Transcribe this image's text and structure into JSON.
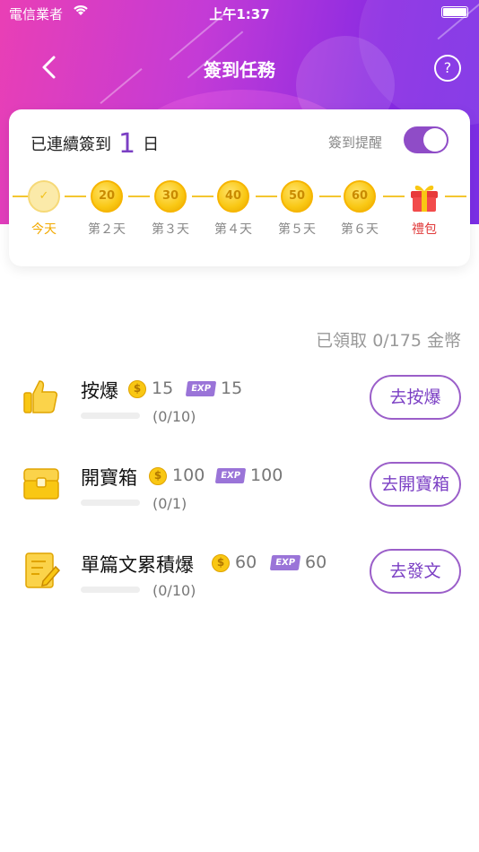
{
  "status_bar": {
    "carrier": "電信業者",
    "time": "上午1:37"
  },
  "nav": {
    "title": "簽到任務",
    "help": "?"
  },
  "checkin": {
    "streak_prefix": "已連續簽到",
    "streak_days": "1",
    "streak_unit": "日",
    "reminder_label": "簽到提醒",
    "reminder_on": true,
    "days": [
      {
        "label": "今天",
        "coin": "✓",
        "state": "done"
      },
      {
        "label": "第２天",
        "coin": "20",
        "state": "pending"
      },
      {
        "label": "第３天",
        "coin": "30",
        "state": "pending"
      },
      {
        "label": "第４天",
        "coin": "40",
        "state": "pending"
      },
      {
        "label": "第５天",
        "coin": "50",
        "state": "pending"
      },
      {
        "label": "第６天",
        "coin": "60",
        "state": "pending"
      },
      {
        "label": "禮包",
        "coin": "gift-icon",
        "state": "gift"
      }
    ]
  },
  "claimed_text": "已領取 0/175 金幣",
  "tasks": [
    {
      "name": "按爆",
      "coin_reward": "15",
      "exp_reward": "15",
      "progress": "(0/10)",
      "progress_fraction": 0,
      "button": "去按爆",
      "icon": "thumbs-up-icon"
    },
    {
      "name": "開寶箱",
      "coin_reward": "100",
      "exp_reward": "100",
      "progress": "(0/1)",
      "progress_fraction": 0,
      "button": "去開寶箱",
      "icon": "treasure-chest-icon"
    },
    {
      "name": "單篇文累積爆",
      "coin_reward": "60",
      "exp_reward": "60",
      "progress": "(0/10)",
      "progress_fraction": 0,
      "button": "去發文",
      "icon": "write-note-icon"
    }
  ],
  "labels": {
    "coin_symbol": "$",
    "exp_badge": "EXP"
  },
  "colors": {
    "accent": "#7b3fc4",
    "coin": "#f9c713",
    "gift": "#e03a3a"
  }
}
